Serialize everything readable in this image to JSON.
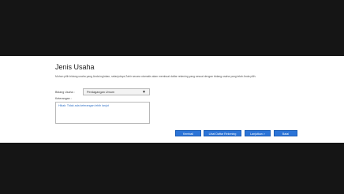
{
  "dialog": {
    "title": "Jenis Usaha",
    "description": "Mohon pilih bidang usaha yang Anda inginkan, selanjutnya Zahir secara otomatis akan membuat daftar rekening yang sesuai dengan bidang usaha yang telah Anda pilih.",
    "bidang_label": "Bidang Usaha :",
    "bidang_value": "Perdagangan Umum",
    "keterangan_label": "Keterangan :",
    "keterangan_value": "Hikak: Tidak ada keterangan lebih lanjut",
    "buttons": {
      "back": "Kembali",
      "list": "Lihat Daftar Rekening",
      "next": "Lanjutkan >",
      "cancel": "Batal"
    }
  },
  "icons": {
    "dropdown": "chevron-down-icon"
  }
}
